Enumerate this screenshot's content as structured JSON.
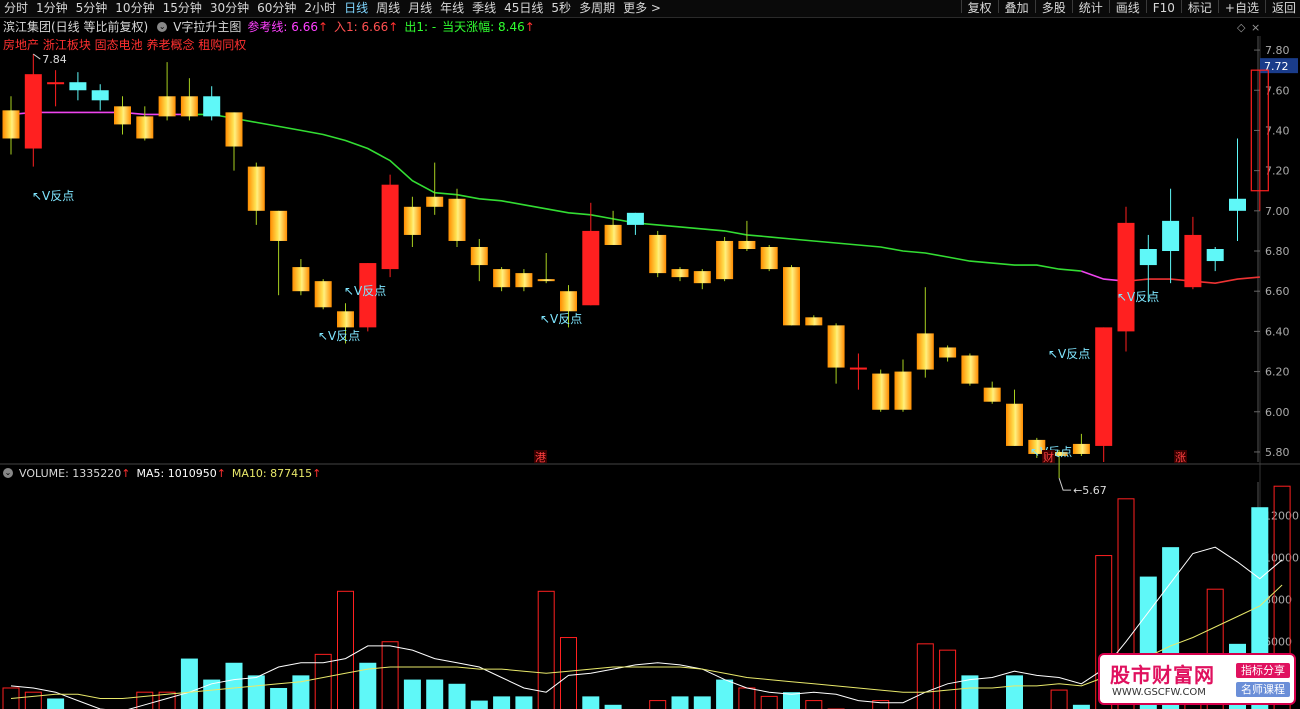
{
  "toolbar": {
    "periods": [
      "分时",
      "1分钟",
      "5分钟",
      "10分钟",
      "15分钟",
      "30分钟",
      "60分钟",
      "2小时",
      "日线",
      "周线",
      "月线",
      "年线",
      "季线",
      "45日线",
      "5秒",
      "多周期",
      "更多 >"
    ],
    "active": "日线",
    "right": [
      "复权",
      "叠加",
      "多股",
      "统计",
      "画线",
      "F10",
      "标记",
      "+自选",
      "返回"
    ]
  },
  "info": {
    "stock": "滨江集团(日线 等比前复权)",
    "indicator": "V字拉升主图",
    "ref_label": "参考线: 6.66",
    "ref_arrow": "↑",
    "in_label": "入1: 6.66",
    "in_arrow": "↑",
    "out_label": "出1: -",
    "today_label": "当天涨幅: 8.46",
    "today_arrow": "↑"
  },
  "tags": "房地产 浙江板块 固态电池 养老概念 租购同权",
  "colors": {
    "up": "#ff2020",
    "down_fill": "#ffc000",
    "cyan": "#5ff8f8",
    "ma_green": "#33dd33",
    "ma_magenta": "#ee44ee",
    "ma_red": "#ee3333",
    "text_cyan": "#7fe6ff",
    "vol_ma5": "#ffffff",
    "vol_ma10": "#e8e86a"
  },
  "chart_data": {
    "type": "candlestick",
    "price_axis": {
      "ylim": [
        5.75,
        7.87
      ],
      "ticks": [
        "7.80",
        "7.60",
        "7.40",
        "7.20",
        "7.00",
        "6.80",
        "6.60",
        "6.40",
        "6.20",
        "6.00",
        "5.80"
      ]
    },
    "current_price": "7.72",
    "high_label": "7.84",
    "low_label": "5.67",
    "signal_label": "V反点",
    "event_markers": [
      "港",
      "财",
      "涨"
    ],
    "candles": [
      {
        "o": 7.36,
        "c": 7.5,
        "h": 7.57,
        "l": 7.28,
        "style": "gold"
      },
      {
        "o": 7.31,
        "c": 7.68,
        "h": 7.78,
        "l": 7.22,
        "style": "red"
      },
      {
        "o": 7.63,
        "c": 7.64,
        "h": 7.7,
        "l": 7.52,
        "style": "doji"
      },
      {
        "o": 7.6,
        "c": 7.64,
        "h": 7.69,
        "l": 7.55,
        "style": "cyan"
      },
      {
        "o": 7.6,
        "c": 7.55,
        "h": 7.63,
        "l": 7.5,
        "style": "cyan"
      },
      {
        "o": 7.43,
        "c": 7.52,
        "h": 7.57,
        "l": 7.38,
        "style": "gold"
      },
      {
        "o": 7.36,
        "c": 7.47,
        "h": 7.52,
        "l": 7.35,
        "style": "gold"
      },
      {
        "o": 7.47,
        "c": 7.57,
        "h": 7.74,
        "l": 7.45,
        "style": "gold"
      },
      {
        "o": 7.47,
        "c": 7.57,
        "h": 7.66,
        "l": 7.45,
        "style": "gold"
      },
      {
        "o": 7.47,
        "c": 7.57,
        "h": 7.62,
        "l": 7.45,
        "style": "cyan"
      },
      {
        "o": 7.49,
        "c": 7.32,
        "h": 7.49,
        "l": 7.2,
        "style": "gold"
      },
      {
        "o": 7.22,
        "c": 7.0,
        "h": 7.24,
        "l": 6.93,
        "style": "gold"
      },
      {
        "o": 7.0,
        "c": 6.85,
        "h": 7.0,
        "l": 6.58,
        "style": "gold"
      },
      {
        "o": 6.72,
        "c": 6.6,
        "h": 6.76,
        "l": 6.58,
        "style": "gold"
      },
      {
        "o": 6.65,
        "c": 6.52,
        "h": 6.66,
        "l": 6.51,
        "style": "gold"
      },
      {
        "o": 6.5,
        "c": 6.42,
        "h": 6.54,
        "l": 6.34,
        "style": "gold"
      },
      {
        "o": 6.42,
        "c": 6.74,
        "h": 6.74,
        "l": 6.4,
        "style": "red"
      },
      {
        "o": 6.71,
        "c": 7.13,
        "h": 7.18,
        "l": 6.67,
        "style": "red"
      },
      {
        "o": 7.02,
        "c": 6.88,
        "h": 7.07,
        "l": 6.82,
        "style": "gold"
      },
      {
        "o": 7.07,
        "c": 7.02,
        "h": 7.24,
        "l": 6.98,
        "style": "gold"
      },
      {
        "o": 7.06,
        "c": 6.85,
        "h": 7.11,
        "l": 6.82,
        "style": "gold"
      },
      {
        "o": 6.82,
        "c": 6.73,
        "h": 6.86,
        "l": 6.65,
        "style": "gold"
      },
      {
        "o": 6.71,
        "c": 6.62,
        "h": 6.72,
        "l": 6.6,
        "style": "gold"
      },
      {
        "o": 6.69,
        "c": 6.62,
        "h": 6.71,
        "l": 6.6,
        "style": "gold"
      },
      {
        "o": 6.66,
        "c": 6.65,
        "h": 6.79,
        "l": 6.64,
        "style": "gold"
      },
      {
        "o": 6.6,
        "c": 6.5,
        "h": 6.63,
        "l": 6.42,
        "style": "gold"
      },
      {
        "o": 6.53,
        "c": 6.9,
        "h": 7.04,
        "l": 6.53,
        "style": "red"
      },
      {
        "o": 6.93,
        "c": 6.83,
        "h": 7.0,
        "l": 6.83,
        "style": "gold"
      },
      {
        "o": 6.93,
        "c": 6.99,
        "h": 6.99,
        "l": 6.88,
        "style": "cyan"
      },
      {
        "o": 6.88,
        "c": 6.69,
        "h": 6.9,
        "l": 6.67,
        "style": "gold"
      },
      {
        "o": 6.71,
        "c": 6.67,
        "h": 6.72,
        "l": 6.65,
        "style": "gold"
      },
      {
        "o": 6.7,
        "c": 6.64,
        "h": 6.71,
        "l": 6.61,
        "style": "gold"
      },
      {
        "o": 6.66,
        "c": 6.85,
        "h": 6.87,
        "l": 6.65,
        "style": "gold"
      },
      {
        "o": 6.81,
        "c": 6.85,
        "h": 6.95,
        "l": 6.8,
        "style": "gold"
      },
      {
        "o": 6.82,
        "c": 6.71,
        "h": 6.83,
        "l": 6.7,
        "style": "gold"
      },
      {
        "o": 6.72,
        "c": 6.43,
        "h": 6.73,
        "l": 6.43,
        "style": "gold"
      },
      {
        "o": 6.47,
        "c": 6.43,
        "h": 6.48,
        "l": 6.43,
        "style": "gold"
      },
      {
        "o": 6.43,
        "c": 6.22,
        "h": 6.44,
        "l": 6.14,
        "style": "gold"
      },
      {
        "o": 6.22,
        "c": 6.21,
        "h": 6.29,
        "l": 6.11,
        "style": "doji"
      },
      {
        "o": 6.19,
        "c": 6.01,
        "h": 6.21,
        "l": 6.0,
        "style": "gold"
      },
      {
        "o": 6.2,
        "c": 6.01,
        "h": 6.26,
        "l": 6.0,
        "style": "gold"
      },
      {
        "o": 6.39,
        "c": 6.21,
        "h": 6.62,
        "l": 6.17,
        "style": "gold"
      },
      {
        "o": 6.32,
        "c": 6.27,
        "h": 6.33,
        "l": 6.25,
        "style": "gold"
      },
      {
        "o": 6.28,
        "c": 6.14,
        "h": 6.29,
        "l": 6.13,
        "style": "gold"
      },
      {
        "o": 6.12,
        "c": 6.05,
        "h": 6.15,
        "l": 6.04,
        "style": "gold"
      },
      {
        "o": 6.04,
        "c": 5.83,
        "h": 6.11,
        "l": 5.83,
        "style": "gold"
      },
      {
        "o": 5.86,
        "c": 5.79,
        "h": 5.87,
        "l": 5.77,
        "style": "gold"
      },
      {
        "o": 5.8,
        "c": 5.78,
        "h": 5.81,
        "l": 5.67,
        "style": "gold"
      },
      {
        "o": 5.84,
        "c": 5.79,
        "h": 5.89,
        "l": 5.78,
        "style": "gold"
      },
      {
        "o": 5.83,
        "c": 6.42,
        "h": 6.42,
        "l": 5.75,
        "style": "red"
      },
      {
        "o": 6.4,
        "c": 6.94,
        "h": 7.02,
        "l": 6.3,
        "style": "red"
      },
      {
        "o": 6.73,
        "c": 6.81,
        "h": 6.88,
        "l": 6.55,
        "style": "cyan"
      },
      {
        "o": 6.8,
        "c": 6.95,
        "h": 7.11,
        "l": 6.64,
        "style": "cyan"
      },
      {
        "o": 6.88,
        "c": 6.62,
        "h": 6.97,
        "l": 6.61,
        "style": "red"
      },
      {
        "o": 6.75,
        "c": 6.81,
        "h": 6.82,
        "l": 6.7,
        "style": "cyan"
      },
      {
        "o": 7.0,
        "c": 7.06,
        "h": 7.36,
        "l": 6.85,
        "style": "cyan"
      },
      {
        "o": 7.1,
        "c": 7.7,
        "h": 7.7,
        "l": 7.0,
        "style": "hollow"
      }
    ],
    "ma_line": [
      7.48,
      7.49,
      7.49,
      7.49,
      7.49,
      7.49,
      7.48,
      7.48,
      7.48,
      7.48,
      7.46,
      7.44,
      7.42,
      7.4,
      7.38,
      7.35,
      7.31,
      7.25,
      7.15,
      7.09,
      7.08,
      7.06,
      7.05,
      7.03,
      7.01,
      6.99,
      6.98,
      6.96,
      6.94,
      6.93,
      6.92,
      6.91,
      6.9,
      6.88,
      6.87,
      6.86,
      6.85,
      6.84,
      6.83,
      6.82,
      6.8,
      6.79,
      6.77,
      6.75,
      6.74,
      6.73,
      6.73,
      6.71,
      6.7,
      6.66,
      6.65,
      6.66,
      6.66,
      6.65,
      6.64,
      6.66,
      6.67
    ],
    "ma_segments": [
      [
        0,
        8,
        "magenta"
      ],
      [
        8,
        48,
        "green"
      ],
      [
        48,
        50,
        "magenta"
      ],
      [
        50,
        56,
        "red"
      ]
    ],
    "signals": [
      1,
      15,
      16,
      24,
      48,
      50,
      54
    ],
    "volume": {
      "label": "VOLUME: 1335220",
      "ma5_label": "MA5: 1010950",
      "ma10_label": "MA10: 877415",
      "arrow": "↑",
      "axis": {
        "ylim": [
          2800,
          13600
        ],
        "ticks": [
          "12000",
          "10000",
          "8000",
          "6000",
          "4000"
        ]
      },
      "bars": [
        3800,
        3600,
        3300,
        2700,
        2700,
        2500,
        3600,
        3600,
        5200,
        4200,
        5000,
        4400,
        3800,
        4400,
        5400,
        8400,
        5000,
        6000,
        4200,
        4200,
        4000,
        3200,
        3400,
        3400,
        8400,
        6200,
        3400,
        3000,
        2700,
        3200,
        3400,
        3400,
        4200,
        3800,
        3400,
        3600,
        3200,
        2800,
        2800,
        3200,
        2800,
        5900,
        5600,
        4400,
        2600,
        4400,
        2800,
        3700,
        3000,
        10100,
        12800,
        9100,
        10500,
        5400,
        8500,
        5900,
        12400,
        13400
      ],
      "styles": [
        "red",
        "red",
        "cyan",
        "cyan",
        "cyan",
        "red",
        "red",
        "red",
        "cyan",
        "cyan",
        "cyan",
        "cyan",
        "cyan",
        "cyan",
        "red",
        "red",
        "cyan",
        "red",
        "cyan",
        "cyan",
        "cyan",
        "cyan",
        "cyan",
        "cyan",
        "red",
        "red",
        "cyan",
        "cyan",
        "cyan",
        "red",
        "cyan",
        "cyan",
        "cyan",
        "red",
        "red",
        "cyan",
        "red",
        "red",
        "cyan",
        "red",
        "cyan",
        "red",
        "red",
        "cyan",
        "cyan",
        "cyan",
        "cyan",
        "red",
        "cyan",
        "red",
        "red",
        "cyan",
        "cyan",
        "red",
        "red",
        "cyan",
        "cyan",
        "red"
      ],
      "ma5": [
        3900,
        3800,
        3600,
        3200,
        2800,
        2700,
        3000,
        3300,
        3600,
        4000,
        4200,
        4300,
        4800,
        5000,
        5000,
        5200,
        5800,
        5800,
        5600,
        5200,
        5000,
        4800,
        4300,
        3800,
        3600,
        4400,
        4500,
        4700,
        4900,
        5000,
        4900,
        4700,
        4200,
        3800,
        3600,
        3500,
        3600,
        3500,
        3200,
        3100,
        3100,
        3600,
        4000,
        4200,
        4300,
        4600,
        4400,
        4300,
        4000,
        4700,
        6000,
        7400,
        8800,
        10200,
        10500,
        9800,
        9000,
        9900
      ],
      "ma10": [
        3300,
        3400,
        3500,
        3500,
        3300,
        3300,
        3400,
        3500,
        3600,
        3700,
        3800,
        3900,
        4000,
        4100,
        4300,
        4500,
        4700,
        4800,
        4800,
        4800,
        4800,
        4700,
        4700,
        4600,
        4500,
        4600,
        4700,
        4800,
        4800,
        4800,
        4800,
        4700,
        4500,
        4300,
        4200,
        4100,
        4000,
        3900,
        3800,
        3700,
        3600,
        3600,
        3700,
        3800,
        3800,
        3900,
        3900,
        4000,
        3900,
        4300,
        4800,
        5300,
        5800,
        6200,
        6700,
        7200,
        7700,
        8700
      ]
    }
  },
  "watermark": {
    "title": "股市财富网",
    "url": "WWW.GSCFW.COM",
    "badge1": "指标分享",
    "badge2": "名师课程"
  }
}
